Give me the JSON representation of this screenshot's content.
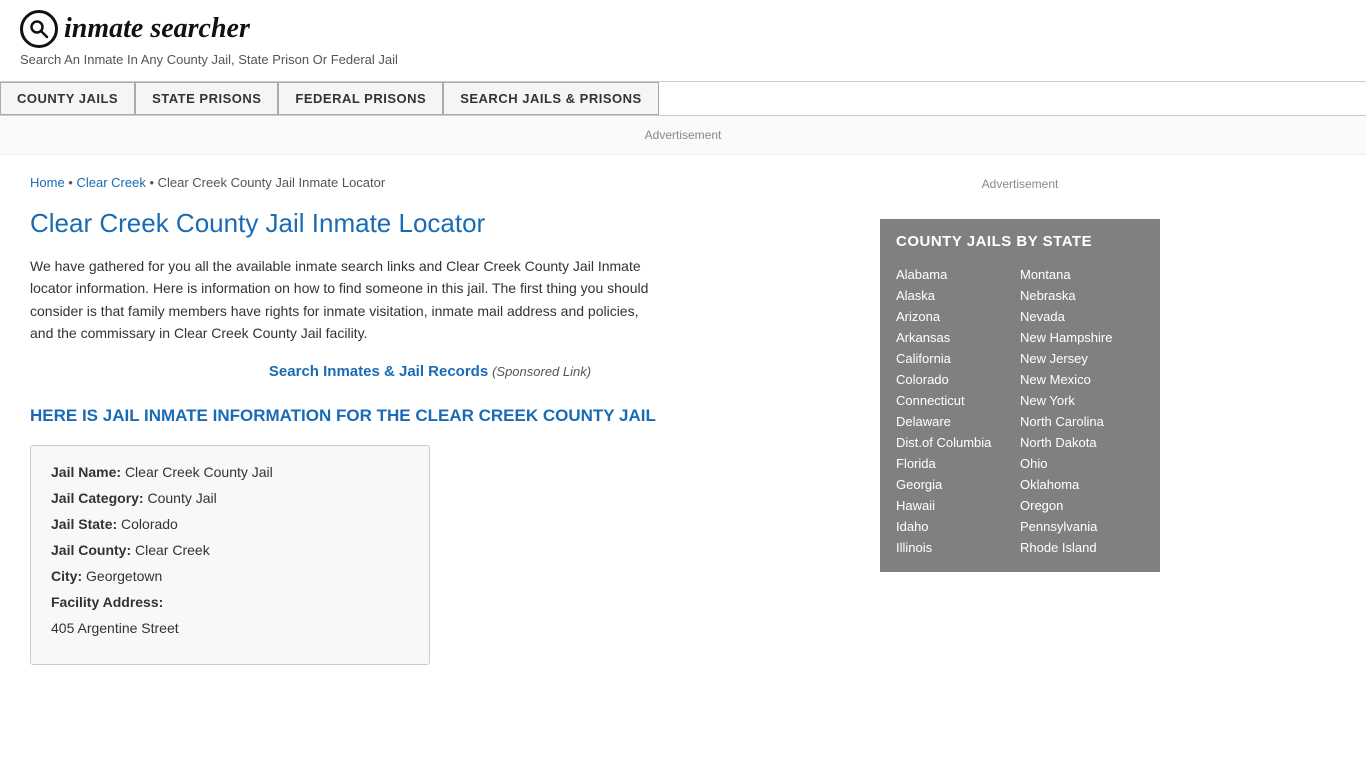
{
  "header": {
    "logo_icon": "🔍",
    "logo_text": "inmate searcher",
    "tagline": "Search An Inmate In Any County Jail, State Prison Or Federal Jail"
  },
  "nav": {
    "buttons": [
      {
        "id": "county-jails",
        "label": "COUNTY JAILS"
      },
      {
        "id": "state-prisons",
        "label": "STATE PRISONS"
      },
      {
        "id": "federal-prisons",
        "label": "FEDERAL PRISONS"
      },
      {
        "id": "search-jails",
        "label": "SEARCH JAILS & PRISONS"
      }
    ]
  },
  "ad_bar": {
    "label": "Advertisement"
  },
  "breadcrumb": {
    "home": "Home",
    "county": "Clear Creek",
    "current": "Clear Creek County Jail Inmate Locator"
  },
  "page_title": "Clear Creek County Jail Inmate Locator",
  "description": "We have gathered for you all the available inmate search links and Clear Creek County Jail Inmate locator information. Here is information on how to find someone in this jail. The first thing you should consider is that family members have rights for inmate visitation, inmate mail address and policies, and the commissary in Clear Creek County Jail facility.",
  "search_link": {
    "text": "Search Inmates & Jail Records",
    "sponsored": "(Sponsored Link)"
  },
  "section_heading": "HERE IS JAIL INMATE INFORMATION FOR THE CLEAR CREEK COUNTY JAIL",
  "info_box": {
    "fields": [
      {
        "label": "Jail Name:",
        "value": "Clear Creek County Jail"
      },
      {
        "label": "Jail Category:",
        "value": "County Jail"
      },
      {
        "label": "Jail State:",
        "value": "Colorado"
      },
      {
        "label": "Jail County:",
        "value": "Clear Creek"
      },
      {
        "label": "City:",
        "value": "Georgetown"
      },
      {
        "label": "Facility Address:",
        "value": ""
      },
      {
        "label": "",
        "value": "405 Argentine Street"
      }
    ]
  },
  "sidebar": {
    "ad_label": "Advertisement",
    "county_jails_title": "COUNTY JAILS BY STATE",
    "states_col1": [
      "Alabama",
      "Alaska",
      "Arizona",
      "Arkansas",
      "California",
      "Colorado",
      "Connecticut",
      "Delaware",
      "Dist.of Columbia",
      "Florida",
      "Georgia",
      "Hawaii",
      "Idaho",
      "Illinois"
    ],
    "states_col2": [
      "Montana",
      "Nebraska",
      "Nevada",
      "New Hampshire",
      "New Jersey",
      "New Mexico",
      "New York",
      "North Carolina",
      "North Dakota",
      "Ohio",
      "Oklahoma",
      "Oregon",
      "Pennsylvania",
      "Rhode Island"
    ]
  }
}
